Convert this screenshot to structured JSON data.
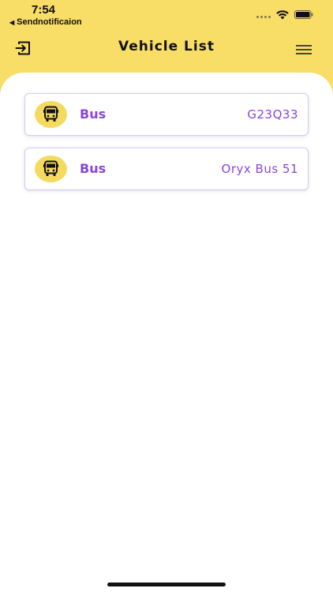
{
  "status_bar": {
    "time": "7:54",
    "back_app_label": "Sendnotificaion"
  },
  "header": {
    "title": "Vehicle List",
    "logout_icon": "logout-icon",
    "menu_icon": "hamburger-menu-icon"
  },
  "vehicles": [
    {
      "type": "Bus",
      "number": "G23Q33",
      "icon": "bus-icon"
    },
    {
      "type": "Bus",
      "number": "Oryx Bus 51",
      "icon": "bus-icon"
    }
  ],
  "colors": {
    "header_background": "#F8DD67",
    "accent_purple": "#8A45D8",
    "icon_circle": "#F5DA60"
  }
}
